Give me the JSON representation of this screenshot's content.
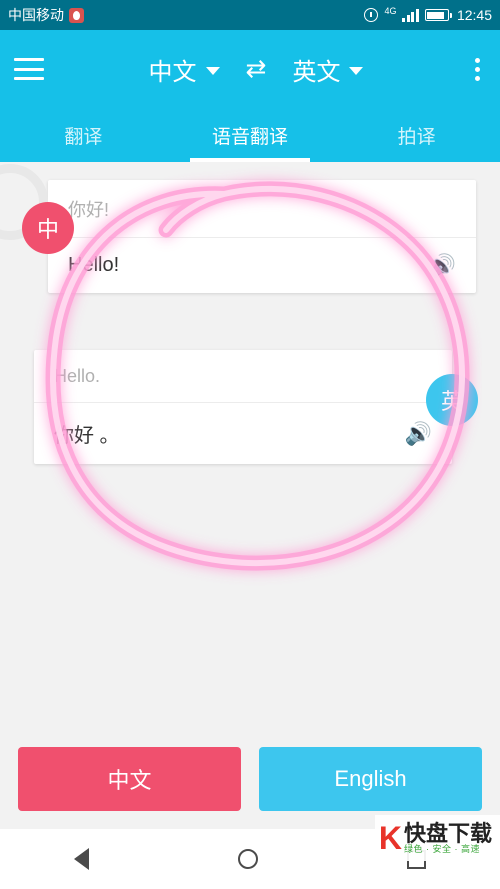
{
  "status_bar": {
    "carrier": "中国移动",
    "qq_icon": "qq-icon",
    "alarm_icon": "alarm-icon",
    "network_type": "4G",
    "signal_icon": "signal-bars-icon",
    "battery_icon": "battery-icon",
    "clock": "12:45"
  },
  "app_bar": {
    "menu_icon": "hamburger-menu-icon",
    "source_lang": "中文",
    "swap_icon": "⇄",
    "target_lang": "英文",
    "overflow_icon": "overflow-menu-icon"
  },
  "tabs": [
    {
      "label": "翻译",
      "active": false
    },
    {
      "label": "语音翻译",
      "active": true
    },
    {
      "label": "拍译",
      "active": false
    }
  ],
  "conversation": [
    {
      "avatar": "中",
      "avatar_side": "left",
      "source_text": "你好!",
      "translated_text": "Hello!",
      "speaker_icon": "speaker-icon",
      "speaker_color": "#f0506e"
    },
    {
      "avatar": "英",
      "avatar_side": "right",
      "source_text": "Hello.",
      "translated_text": "你好 。",
      "speaker_icon": "speaker-icon",
      "speaker_color": "#3dc6ee"
    }
  ],
  "bottom_buttons": [
    {
      "label": "中文",
      "color": "#f0506e"
    },
    {
      "label": "English",
      "color": "#3dc6ee"
    }
  ],
  "nav_bar": {
    "back_icon": "back-triangle-icon",
    "home_icon": "home-circle-icon",
    "recent_icon": "recents-square-icon"
  },
  "watermark": {
    "logo": "K",
    "title": "快盘下载",
    "subtitle": "绿色 · 安全 · 高速"
  },
  "colors": {
    "status_bar": "#00708a",
    "app_bar": "#16c0e8",
    "accent_red": "#f0506e",
    "accent_blue": "#3dc6ee",
    "annotation_pink": "#ff8fd0"
  }
}
